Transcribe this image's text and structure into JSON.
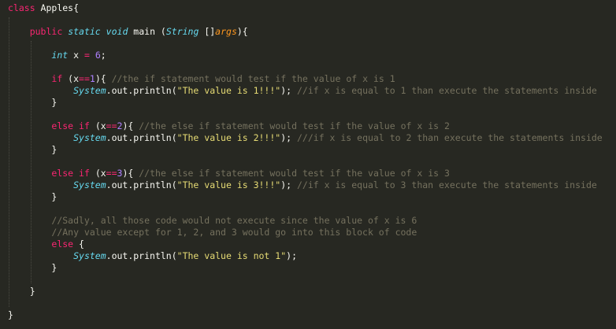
{
  "theme": {
    "background": "#272822",
    "plain": "#f8f8f2",
    "keyword": "#f92672",
    "type": "#66d9ef",
    "argument": "#fd971f",
    "number": "#ae81ff",
    "string": "#e6db74",
    "comment": "#75715e",
    "indent_guide": "#4a4a42"
  },
  "code": {
    "language": "Java",
    "lines": [
      [
        [
          "kw",
          "class"
        ],
        [
          "pl",
          " Apples{"
        ]
      ],
      [],
      [
        [
          "pl",
          "    "
        ],
        [
          "kw",
          "public"
        ],
        [
          "pl",
          " "
        ],
        [
          "typ",
          "static"
        ],
        [
          "pl",
          " "
        ],
        [
          "typ",
          "void"
        ],
        [
          "pl",
          " main ("
        ],
        [
          "typ",
          "String"
        ],
        [
          "pl",
          " []"
        ],
        [
          "arg",
          "args"
        ],
        [
          "pl",
          "){"
        ]
      ],
      [],
      [
        [
          "pl",
          "        "
        ],
        [
          "typ",
          "int"
        ],
        [
          "pl",
          " x "
        ],
        [
          "kw",
          "="
        ],
        [
          "pl",
          " "
        ],
        [
          "num",
          "6"
        ],
        [
          "pl",
          ";"
        ]
      ],
      [],
      [
        [
          "pl",
          "        "
        ],
        [
          "kw",
          "if"
        ],
        [
          "pl",
          " (x"
        ],
        [
          "kw",
          "=="
        ],
        [
          "num",
          "1"
        ],
        [
          "pl",
          "){ "
        ],
        [
          "cmt",
          "//the if statement would test if the value of x is 1"
        ]
      ],
      [
        [
          "pl",
          "            "
        ],
        [
          "cls",
          "System"
        ],
        [
          "pl",
          ".out.println("
        ],
        [
          "str",
          "\"The value is 1!!!\""
        ],
        [
          "pl",
          "); "
        ],
        [
          "cmt",
          "//if x is equal to 1 than execute the statements inside"
        ]
      ],
      [
        [
          "pl",
          "        }"
        ]
      ],
      [],
      [
        [
          "pl",
          "        "
        ],
        [
          "kw",
          "else"
        ],
        [
          "pl",
          " "
        ],
        [
          "kw",
          "if"
        ],
        [
          "pl",
          " (x"
        ],
        [
          "kw",
          "=="
        ],
        [
          "num",
          "2"
        ],
        [
          "pl",
          "){ "
        ],
        [
          "cmt",
          "//the else if statement would test if the value of x is 2"
        ]
      ],
      [
        [
          "pl",
          "            "
        ],
        [
          "cls",
          "System"
        ],
        [
          "pl",
          ".out.println("
        ],
        [
          "str",
          "\"The value is 2!!!\""
        ],
        [
          "pl",
          "); "
        ],
        [
          "cmt",
          "///if x is equal to 2 than execute the statements inside"
        ]
      ],
      [
        [
          "pl",
          "        }"
        ]
      ],
      [],
      [
        [
          "pl",
          "        "
        ],
        [
          "kw",
          "else"
        ],
        [
          "pl",
          " "
        ],
        [
          "kw",
          "if"
        ],
        [
          "pl",
          " (x"
        ],
        [
          "kw",
          "=="
        ],
        [
          "num",
          "3"
        ],
        [
          "pl",
          "){ "
        ],
        [
          "cmt",
          "//the else if statement would test if the value of x is 3"
        ]
      ],
      [
        [
          "pl",
          "            "
        ],
        [
          "cls",
          "System"
        ],
        [
          "pl",
          ".out.println("
        ],
        [
          "str",
          "\"The value is 3!!!\""
        ],
        [
          "pl",
          "); "
        ],
        [
          "cmt",
          "//if x is equal to 3 than execute the statements inside"
        ]
      ],
      [
        [
          "pl",
          "        }"
        ]
      ],
      [],
      [
        [
          "pl",
          "        "
        ],
        [
          "cmt",
          "//Sadly, all those code would not execute since the value of x is 6"
        ]
      ],
      [
        [
          "pl",
          "        "
        ],
        [
          "cmt",
          "//Any value except for 1, 2, and 3 would go into this block of code"
        ]
      ],
      [
        [
          "pl",
          "        "
        ],
        [
          "kw",
          "else"
        ],
        [
          "pl",
          " {"
        ]
      ],
      [
        [
          "pl",
          "            "
        ],
        [
          "cls",
          "System"
        ],
        [
          "pl",
          ".out.println("
        ],
        [
          "str",
          "\"The value is not 1\""
        ],
        [
          "pl",
          ");"
        ]
      ],
      [
        [
          "pl",
          "        }"
        ]
      ],
      [],
      [
        [
          "pl",
          "    }"
        ]
      ],
      [],
      [
        [
          "pl",
          "}"
        ]
      ]
    ]
  }
}
